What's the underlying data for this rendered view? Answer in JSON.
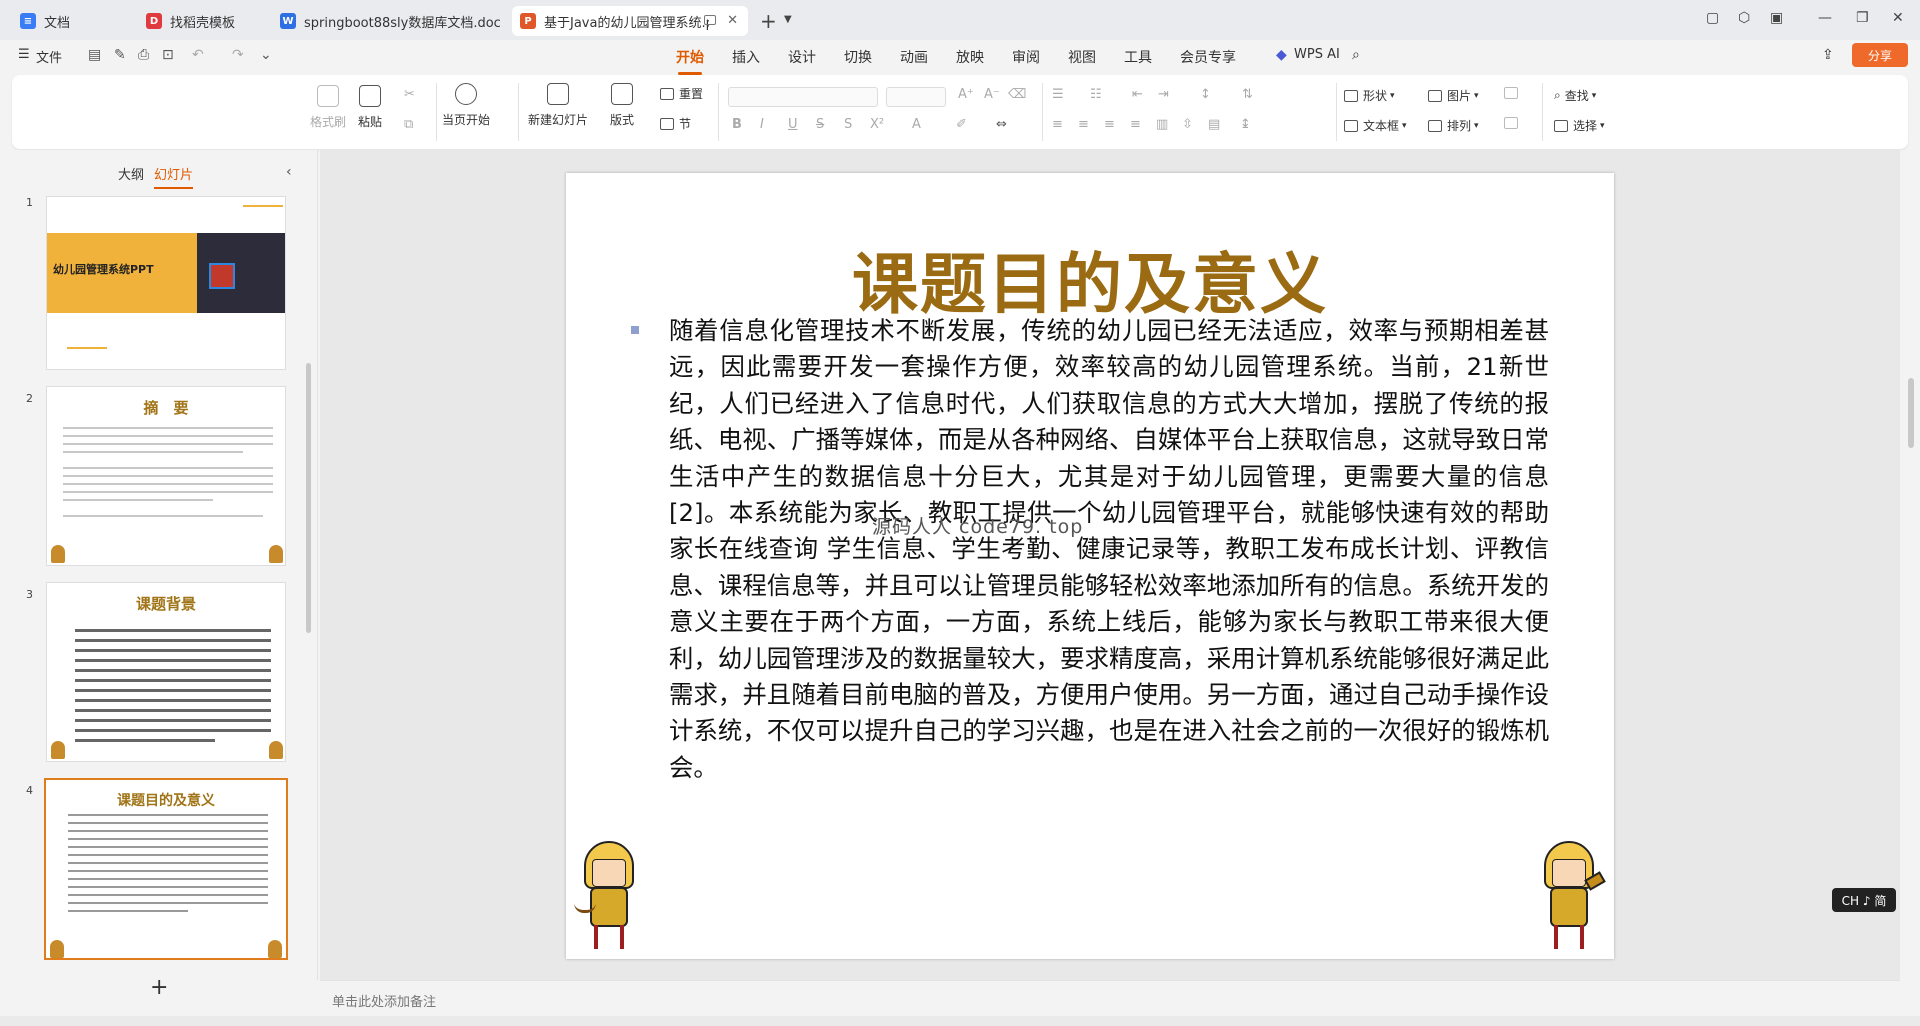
{
  "tabs": [
    {
      "label": "文档",
      "icon": "doc-icon",
      "color": "#3a7cf5",
      "glyph": "≡"
    },
    {
      "label": "找稻壳模板",
      "icon": "docer-icon",
      "color": "#e0393e",
      "glyph": "D"
    },
    {
      "label": "springboot88sly数据库文档.doc",
      "icon": "word-icon",
      "color": "#2f6fe4",
      "glyph": "W"
    },
    {
      "label": "基于Java的幼儿园管理系统.p",
      "icon": "ppt-icon",
      "color": "#e0572a",
      "glyph": "P"
    }
  ],
  "menu": {
    "file": "文件",
    "tabs": [
      "开始",
      "插入",
      "设计",
      "切换",
      "动画",
      "放映",
      "审阅",
      "视图",
      "工具",
      "会员专享"
    ],
    "wps_ai": "WPS AI",
    "share": "分享"
  },
  "ribbon": {
    "format_painter": "格式刷",
    "paste": "粘贴",
    "play_from_current": "当页开始",
    "new_slide": "新建幻灯片",
    "layout": "版式",
    "reset": "重置",
    "section": "节",
    "shape": "形状",
    "picture": "图片",
    "textbox": "文本框",
    "arrange": "排列",
    "find": "查找",
    "select": "选择",
    "font_buttons": [
      "B",
      "I",
      "U",
      "S",
      "S",
      "X²"
    ]
  },
  "sidebar": {
    "tab_outline": "大纲",
    "tab_slides": "幻灯片",
    "slides": [
      {
        "num": "1",
        "title": "幼儿园管理系统PPT"
      },
      {
        "num": "2",
        "title": "摘　要"
      },
      {
        "num": "3",
        "title": "课题背景"
      },
      {
        "num": "4",
        "title": "课题目的及意义"
      }
    ]
  },
  "slide": {
    "title": "课题目的及意义",
    "body": "随着信息化管理技术不断发展，传统的幼儿园已经无法适应，效率与预期相差甚远，因此需要开发一套操作方便，效率较高的幼儿园管理系统。当前，21新世纪，人们已经进入了信息时代，人们获取信息的方式大大增加，摆脱了传统的报纸、电视、广播等媒体，而是从各种网络、自媒体平台上获取信息，这就导致日常生活中产生的数据信息十分巨大，尤其是对于幼儿园管理，更需要大量的信息[2]。本系统能为家长、教职工提供一个幼儿园管理平台，就能够快速有效的帮助家长在线查询 学生信息、学生考勤、健康记录等，教职工发布成长计划、评教信息、课程信息等，并且可以让管理员能够轻松效率地添加所有的信息。系统开发的意义主要在于两个方面，一方面，系统上线后，能够为家长与教职工带来很大便利，幼儿园管理涉及的数据量较大，要求精度高，采用计算机系统能够很好满足此需求，并且随着目前电脑的普及，方便用户使用。另一方面，通过自己动手操作设计系统，不仅可以提升自己的学习兴趣，也是在进入社会之前的一次很好的锻炼机会。",
    "watermark": "源码人人 code79. top"
  },
  "notes_placeholder": "单击此处添加备注",
  "ime": "CH ♪ 简",
  "colors": {
    "accent": "#e05a00",
    "title_gold": "#9a6b12",
    "share_bg": "#ef6a2a"
  }
}
